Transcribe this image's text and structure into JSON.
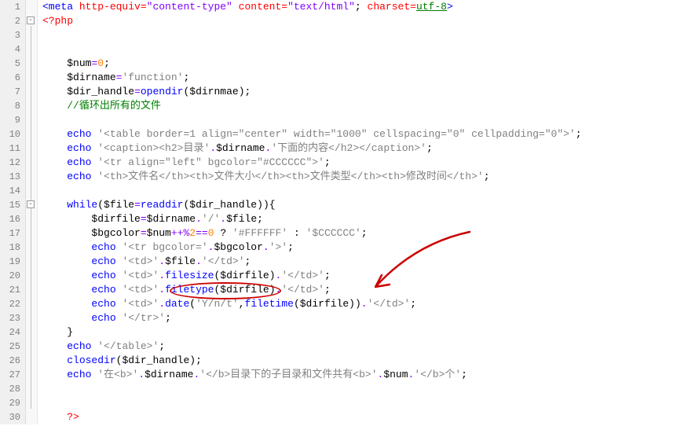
{
  "lines": {
    "l1_meta_open": "<meta ",
    "l1_attr1": "http-equiv=",
    "l1_val1": "\"content-type\"",
    "l1_attr2": " content=",
    "l1_val2": "\"text/html\"",
    "l1_sep": "; ",
    "l1_attr3": "charset=",
    "l1_val3": "utf-8",
    "l1_close": ">",
    "l2": "<?php",
    "l5": "$num=0;",
    "l5_var": "$num",
    "l5_eq": "=",
    "l5_num": "0",
    "l5_semi": ";",
    "l6_var": "$dirname",
    "l6_eq": "=",
    "l6_str": "'function'",
    "l6_semi": ";",
    "l7_var": "$dir_handle",
    "l7_eq": "=",
    "l7_fn": "opendir",
    "l7_paren_o": "(",
    "l7_arg": "$dirnmae",
    "l7_paren_c": ")",
    "l7_semi": ";",
    "l8": "//循环出所有的文件",
    "l10_echo": "echo",
    "l10_str": " '<table border=1 align=\"center\" width=\"1000\" cellspacing=\"0\" cellpadding=\"0\">'",
    "l10_semi": ";",
    "l11_echo": "echo",
    "l11_str1": " '<caption><h2>目录'",
    "l11_dot": ".",
    "l11_var": "$dirname",
    "l11_dot2": ".",
    "l11_str2": "'下面的内容</h2></caption>'",
    "l11_semi": ";",
    "l12_echo": "echo",
    "l12_str": " '<tr align=\"left\" bgcolor=\"#CCCCCC\">'",
    "l12_semi": ";",
    "l13_echo": "echo",
    "l13_str": " '<th>文件名</th><th>文件大小</th><th>文件类型</th><th>修改时间</th>'",
    "l13_semi": ";",
    "l15_while": "while",
    "l15_po": "(",
    "l15_var": "$file",
    "l15_eq": "=",
    "l15_fn": "readdir",
    "l15_po2": "(",
    "l15_arg": "$dir_handle",
    "l15_pc2": ")",
    "l15_pc": ")",
    "l15_brace": "{",
    "l16_var": "$dirfile",
    "l16_eq": "=",
    "l16_var2": "$dirname",
    "l16_dot": ".",
    "l16_str": "'/'",
    "l16_dot2": ".",
    "l16_var3": "$file",
    "l16_semi": ";",
    "l17_var": "$bgcolor",
    "l17_eq": "=",
    "l17_var2": "$num",
    "l17_op": "++%",
    "l17_num": "2",
    "l17_op2": "==",
    "l17_num2": "0",
    "l17_tern": " ? ",
    "l17_str1": "'#FFFFFF'",
    "l17_colon": " : ",
    "l17_str2": "'$CCCCCC'",
    "l17_semi": ";",
    "l18_echo": "echo",
    "l18_str1": " '<tr bgcolor='",
    "l18_dot": ".",
    "l18_var": "$bgcolor",
    "l18_dot2": ".",
    "l18_str2": "'>'",
    "l18_semi": ";",
    "l19_echo": "echo",
    "l19_str1": " '<td>'",
    "l19_dot": ".",
    "l19_var": "$file",
    "l19_dot2": ".",
    "l19_str2": "'</td>'",
    "l19_semi": ";",
    "l20_echo": "echo",
    "l20_str1": " '<td>'",
    "l20_dot": ".",
    "l20_fn": "filesize",
    "l20_po": "(",
    "l20_arg": "$dirfile",
    "l20_pc": ")",
    "l20_dot2": ".",
    "l20_str2": "'</td>'",
    "l20_semi": ";",
    "l21_echo": "echo",
    "l21_str1": " '<td>'",
    "l21_dot": ".",
    "l21_fn": "filetype",
    "l21_po": "(",
    "l21_arg": "$dirfile",
    "l21_pc": ")",
    "l21_dot2": ".",
    "l21_str2": "'</td>'",
    "l21_semi": ";",
    "l22_echo": "echo",
    "l22_str1": " '<td>'",
    "l22_dot": ".",
    "l22_fn": "date",
    "l22_po": "(",
    "l22_arg1": "'Y/n/t'",
    "l22_comma": ",",
    "l22_fn2": "filetime",
    "l22_po2": "(",
    "l22_arg2": "$dirfile",
    "l22_pc2": ")",
    "l22_pc": ")",
    "l22_dot2": ".",
    "l22_str2": "'</td>'",
    "l22_semi": ";",
    "l23_echo": "echo",
    "l23_str": " '</tr>'",
    "l23_semi": ";",
    "l24_brace": "}",
    "l25_echo": "echo",
    "l25_str": " '</table>'",
    "l25_semi": ";",
    "l26_fn": "closedir",
    "l26_po": "(",
    "l26_arg": "$dir_handle",
    "l26_pc": ")",
    "l26_semi": ";",
    "l27_echo": "echo",
    "l27_str1": " '在<b>'",
    "l27_dot": ".",
    "l27_var": "$dirname",
    "l27_dot2": ".",
    "l27_str2": "'</b>目录下的子目录和文件共有<b>'",
    "l27_dot3": ".",
    "l27_var2": "$num",
    "l27_dot4": ".",
    "l27_str3": "'</b>个'",
    "l27_semi": ";",
    "l30": "?>"
  },
  "line_numbers": [
    "1",
    "2",
    "3",
    "4",
    "5",
    "6",
    "7",
    "8",
    "9",
    "10",
    "11",
    "12",
    "13",
    "14",
    "15",
    "16",
    "17",
    "18",
    "19",
    "20",
    "21",
    "22",
    "23",
    "24",
    "25",
    "26",
    "27",
    "28",
    "29",
    "30"
  ]
}
